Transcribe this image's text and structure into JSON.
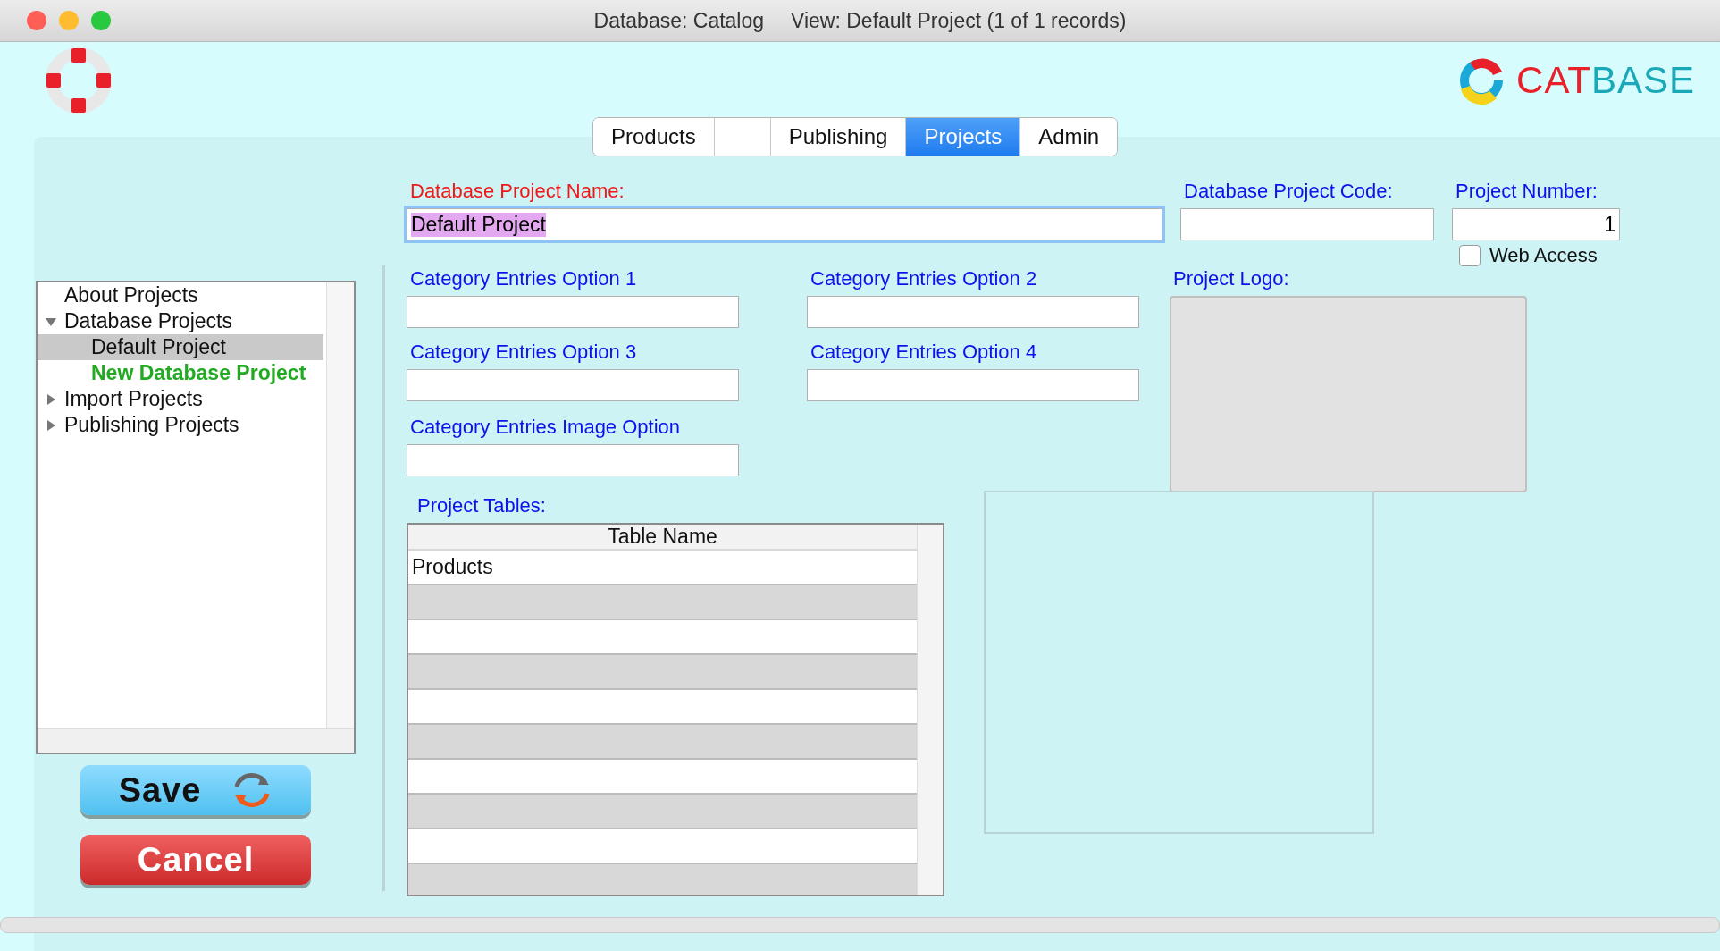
{
  "window": {
    "title": "Database: Catalog",
    "subtitle": "View: Default Project (1 of 1 records)"
  },
  "logo": {
    "first": "CAT",
    "second": "BASE"
  },
  "tabs": [
    {
      "label": "Products",
      "selected": false
    },
    {
      "selected": false
    },
    {
      "label": "Publishing",
      "selected": false
    },
    {
      "label": "Projects",
      "selected": true
    },
    {
      "label": "Admin",
      "selected": false
    }
  ],
  "tree": [
    {
      "label": "About Projects",
      "kind": "leaf",
      "selected": false
    },
    {
      "label": "Database Projects",
      "kind": "folder",
      "expanded": true,
      "selected": false,
      "children": [
        {
          "label": "Default Project",
          "kind": "leaf",
          "selected": true
        },
        {
          "label": "New Database Project",
          "kind": "add",
          "selected": false
        }
      ]
    },
    {
      "label": "Import Projects",
      "kind": "folder",
      "expanded": false,
      "selected": false
    },
    {
      "label": "Publishing Projects",
      "kind": "folder",
      "expanded": false,
      "selected": false
    }
  ],
  "buttons": {
    "save": "Save",
    "cancel": "Cancel"
  },
  "project_name": {
    "label": "Database Project Name:",
    "value": "Default Project"
  },
  "project_code": {
    "label": "Database Project Code:"
  },
  "project_number": {
    "label": "Project Number:",
    "value": "1"
  },
  "web_access": {
    "label": "Web Access",
    "checked": false
  },
  "category_fields": [
    {
      "label": "Category Entries Option 1"
    },
    {
      "label": "Category Entries Option 2"
    },
    {
      "label": "Category Entries Option 3"
    },
    {
      "label": "Category Entries Option 4"
    },
    {
      "label": "Category Entries Image Option"
    }
  ],
  "project_logo": {
    "label": "Project Logo:"
  },
  "project_tables": {
    "label": "Project Tables:",
    "columns": [
      "Table Name"
    ],
    "rows": [
      [
        "Products"
      ]
    ]
  }
}
